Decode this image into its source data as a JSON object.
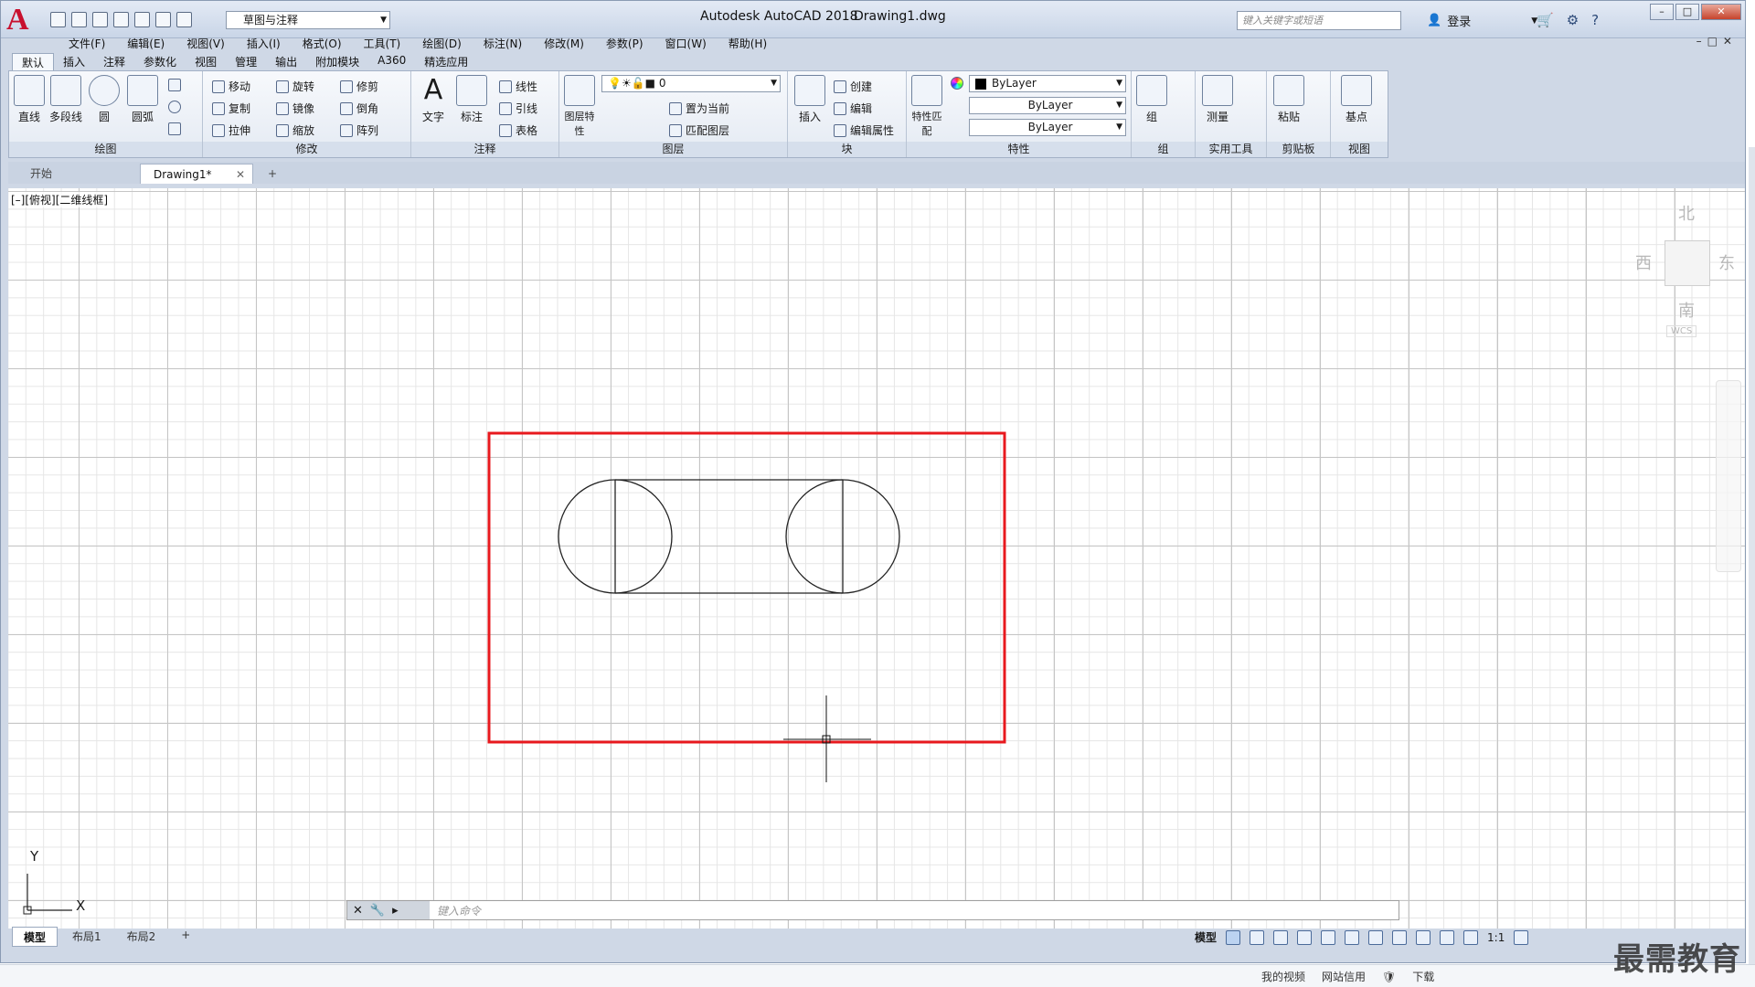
{
  "titlebar": {
    "app_title": "Autodesk AutoCAD 2018",
    "file_name": "Drawing1.dwg",
    "workspace": "草图与注释",
    "search_placeholder": "键入关键字或短语",
    "login_label": "登录"
  },
  "menu": [
    "文件(F)",
    "编辑(E)",
    "视图(V)",
    "插入(I)",
    "格式(O)",
    "工具(T)",
    "绘图(D)",
    "标注(N)",
    "修改(M)",
    "参数(P)",
    "窗口(W)",
    "帮助(H)"
  ],
  "ribbon_tabs": [
    "默认",
    "插入",
    "注释",
    "参数化",
    "视图",
    "管理",
    "输出",
    "附加模块",
    "A360",
    "精选应用"
  ],
  "panels": {
    "draw": {
      "title": "绘图",
      "line": "直线",
      "polyline": "多段线",
      "circle": "圆",
      "arc": "圆弧"
    },
    "modify": {
      "title": "修改",
      "move": "移动",
      "rotate": "旋转",
      "trim": "修剪",
      "copy": "复制",
      "mirror": "镜像",
      "fillet": "倒角",
      "stretch": "拉伸",
      "scale": "缩放",
      "array": "阵列"
    },
    "annotation": {
      "title": "注释",
      "text": "文字",
      "dim": "标注",
      "linear": "线性",
      "leader": "引线",
      "table": "表格"
    },
    "layers": {
      "title": "图层",
      "props": "图层特性",
      "layer_value": "0",
      "set_current": "置为当前",
      "match": "匹配图层"
    },
    "block": {
      "title": "块",
      "insert": "插入",
      "create": "创建",
      "edit": "编辑",
      "edit_attr": "编辑属性"
    },
    "properties": {
      "title": "特性",
      "match": "特性匹配",
      "color": "ByLayer",
      "linetype": "ByLayer",
      "lineweight": "ByLayer"
    },
    "groups": {
      "title": "组",
      "group": "组"
    },
    "utilities": {
      "title": "实用工具",
      "measure": "测量"
    },
    "clipboard": {
      "title": "剪贴板",
      "paste": "粘贴"
    },
    "view": {
      "title": "视图",
      "base": "基点"
    }
  },
  "doc_tabs": {
    "start": "开始",
    "current": "Drawing1*"
  },
  "viewport": {
    "label": "[–][俯视][二维线框]",
    "viewcube": {
      "north": "北",
      "south": "南",
      "east": "东",
      "west": "西",
      "wcs": "WCS"
    },
    "ucs": {
      "x": "X",
      "y": "Y"
    }
  },
  "command": {
    "placeholder": "键入命令"
  },
  "layout_tabs": [
    "模型",
    "布局1",
    "布局2"
  ],
  "status": {
    "model": "模型",
    "scale": "1:1"
  },
  "taskbar": [
    "我的视频",
    "网站信用",
    "下载"
  ],
  "watermark": "最需教育",
  "colors": {
    "highlight_box": "#e8191e",
    "brand": "#c8102e"
  }
}
